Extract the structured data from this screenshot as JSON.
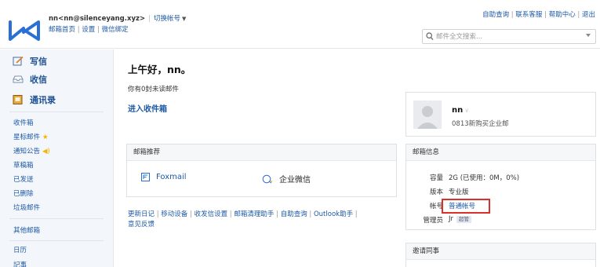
{
  "header": {
    "account_display": "nn<nn@silenceyang.xyz>",
    "switch_account": "切换帐号",
    "links": [
      "邮箱首页",
      "设置",
      "微信绑定"
    ],
    "top_links": [
      "自助查询",
      "联系客服",
      "帮助中心",
      "退出"
    ],
    "search_placeholder": "邮件全文搜索..."
  },
  "sidebar": {
    "compose": "写信",
    "receive": "收信",
    "contacts": "通讯录",
    "folders": [
      "收件箱",
      "星标邮件",
      "通知公告",
      "草稿箱",
      "已发送",
      "已删除",
      "垃圾邮件"
    ],
    "other_mailboxes": "其他邮箱",
    "calendar": "日历",
    "cutoff_item": "記事"
  },
  "main": {
    "greeting": "上午好，nn。",
    "unread_text": "你有0封未读邮件",
    "enter_inbox": "进入收件箱",
    "recommend_title": "邮箱推荐",
    "recommend_items": [
      "Foxmail",
      "企业微信"
    ],
    "bottom_links": [
      "更新日记",
      "移动设备",
      "收发信设置",
      "邮箱清理助手",
      "自助查询",
      "Outlook助手",
      "意见反馈"
    ]
  },
  "profile": {
    "name": "nn",
    "org": "0813新购买企业邮"
  },
  "mailbox_info": {
    "title": "邮箱信息",
    "rows": [
      {
        "label": "容量",
        "value": "2G (已使用：0M，0%)"
      },
      {
        "label": "版本",
        "value": "专业版"
      },
      {
        "label": "帐号",
        "value": "普通帐号"
      },
      {
        "label": "管理员",
        "value": "Jr"
      }
    ],
    "admin_badge": "超管"
  },
  "invite": {
    "title": "邀请同事"
  },
  "colors": {
    "link": "#1d59a6",
    "highlight_border": "#d9302c",
    "sidebar_bg": "#f3f6fa"
  }
}
